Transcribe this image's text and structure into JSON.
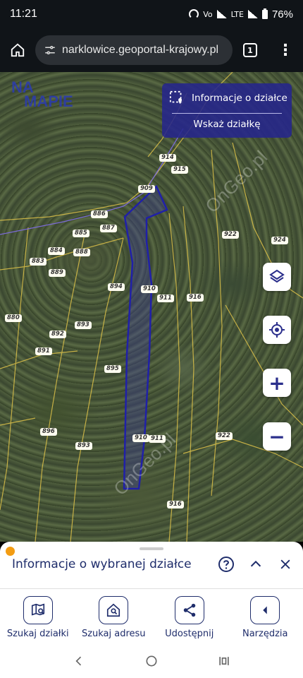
{
  "status": {
    "time": "11:21",
    "battery": "76%",
    "net1": "Vo",
    "net2": "LTE"
  },
  "browser": {
    "url": "narklowice.geoportal-krajowy.pl",
    "tab_count": "1"
  },
  "map": {
    "logo_line1": "NA",
    "logo_line2": "MAPIE",
    "info_title": "Informacje o działce",
    "info_sub": "Wskaż działkę",
    "watermark": "OnGeo.pl",
    "parcels": [
      "909",
      "914",
      "915",
      "886",
      "887",
      "885",
      "884",
      "888",
      "883",
      "889",
      "922",
      "924",
      "894",
      "910",
      "911",
      "916",
      "880",
      "892",
      "893",
      "891",
      "895",
      "896",
      "910",
      "911",
      "922",
      "893",
      "916"
    ]
  },
  "sheet": {
    "title": "Informacje o wybranej działce"
  },
  "toolbar": {
    "items": [
      {
        "label": "Szukaj działki",
        "icon": "map-search-icon"
      },
      {
        "label": "Szukaj adresu",
        "icon": "home-search-icon"
      },
      {
        "label": "Udostępnij",
        "icon": "share-icon"
      },
      {
        "label": "Narzędzia",
        "icon": "tools-icon"
      }
    ]
  },
  "colors": {
    "accent": "#2b2f8c",
    "panel": "#26268c",
    "selected_parcel": "#2020a8"
  }
}
